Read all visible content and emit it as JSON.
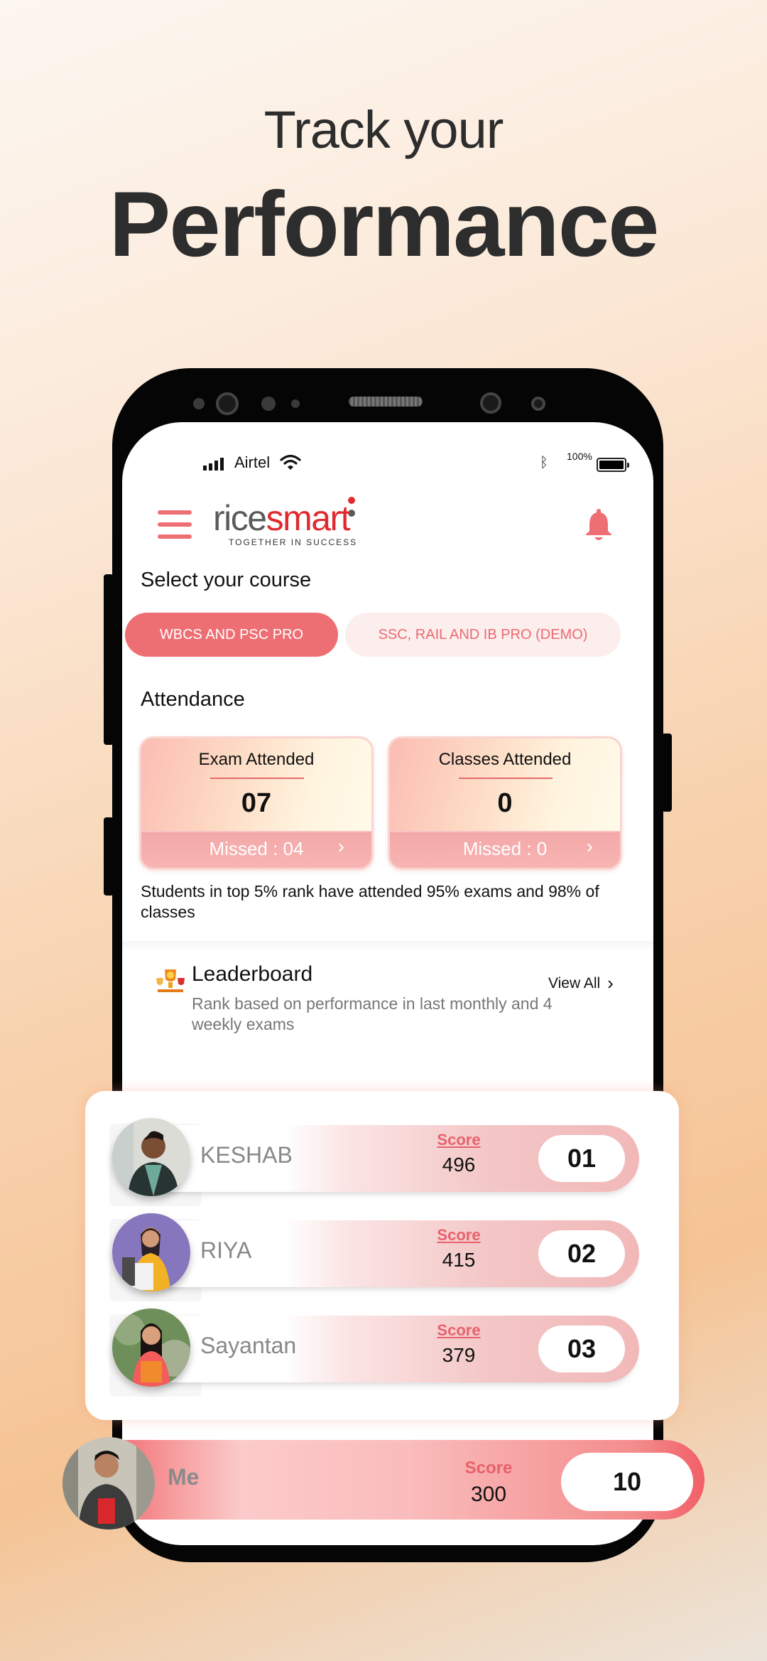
{
  "promo": {
    "line1": "Track your",
    "line2": "Performance"
  },
  "status_bar": {
    "carrier": "Airtel",
    "battery_percent": "100%",
    "icons": [
      "signal-icon",
      "wifi-icon",
      "bluetooth-icon",
      "battery-icon"
    ]
  },
  "header": {
    "logo_part1": "rice",
    "logo_part2": "smart",
    "tagline": "TOGETHER IN SUCCESS",
    "menu_icon": "hamburger-menu-icon",
    "notification_icon": "bell-icon"
  },
  "course": {
    "title": "Select your course",
    "options": [
      {
        "label": "WBCS AND PSC PRO",
        "selected": true
      },
      {
        "label": "SSC, RAIL AND IB PRO (DEMO)",
        "selected": false
      }
    ]
  },
  "attendance": {
    "title": "Attendance",
    "cards": [
      {
        "label": "Exam Attended",
        "value": "07",
        "missed": "Missed : 04"
      },
      {
        "label": "Classes Attended",
        "value": "0",
        "missed": "Missed : 0"
      }
    ],
    "note": "Students in top 5% rank have attended 95% exams and 98% of classes"
  },
  "leaderboard": {
    "title": "Leaderboard",
    "subtitle": "Rank based on performance in last monthly and 4 weekly exams",
    "view_all": "View All",
    "score_label": "Score",
    "entries": [
      {
        "name": "KESHAB",
        "score": "496",
        "rank": "01"
      },
      {
        "name": "RIYA",
        "score": "415",
        "rank": "02"
      },
      {
        "name": "Sayantan",
        "score": "379",
        "rank": "03"
      }
    ],
    "me": {
      "name": "Me",
      "score": "300",
      "rank": "10"
    }
  },
  "colors": {
    "accent": "#ee6f73",
    "brand_red": "#e02a2f",
    "score_label": "#e9616a"
  }
}
